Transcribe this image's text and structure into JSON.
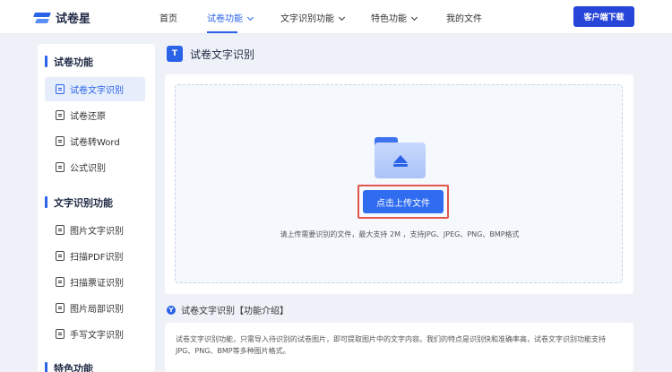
{
  "header": {
    "logo_text": "试卷星",
    "nav": [
      {
        "label": "首页"
      },
      {
        "label": "试卷功能"
      },
      {
        "label": "文字识别功能"
      },
      {
        "label": "特色功能"
      },
      {
        "label": "我的文件"
      }
    ],
    "download_label": "客户端下载"
  },
  "sidebar": {
    "sections": [
      {
        "title": "试卷功能",
        "items": [
          {
            "label": "试卷文字识别"
          },
          {
            "label": "试卷还原"
          },
          {
            "label": "试卷转Word"
          },
          {
            "label": "公式识别"
          }
        ]
      },
      {
        "title": "文字识别功能",
        "items": [
          {
            "label": "图片文字识别"
          },
          {
            "label": "扫描PDF识别"
          },
          {
            "label": "扫描票证识别"
          },
          {
            "label": "图片局部识别"
          },
          {
            "label": "手写文字识别"
          }
        ]
      },
      {
        "title": "特色功能",
        "items": []
      }
    ]
  },
  "main": {
    "page_icon_text": "T",
    "page_title": "试卷文字识别",
    "upload_button": "点击上传文件",
    "upload_hint": "请上传需要识别的文件，最大支持 2M ，支持JPG、JPEG、PNG、BMP格式",
    "intro_icon_text": "Y",
    "intro_title": "试卷文字识别【功能介绍】",
    "intro_text": "试卷文字识别功能，只需导入待识别的试卷图片，即可提取图片中的文字内容。我们的特点是识别快和准确率高，试卷文字识别功能支持JPG、PNG、BMP等多种图片格式。"
  },
  "colors": {
    "accent": "#2a63e8",
    "download_button": "#2745d8",
    "highlight_frame": "#e2554a",
    "background": "#eef1f7"
  }
}
